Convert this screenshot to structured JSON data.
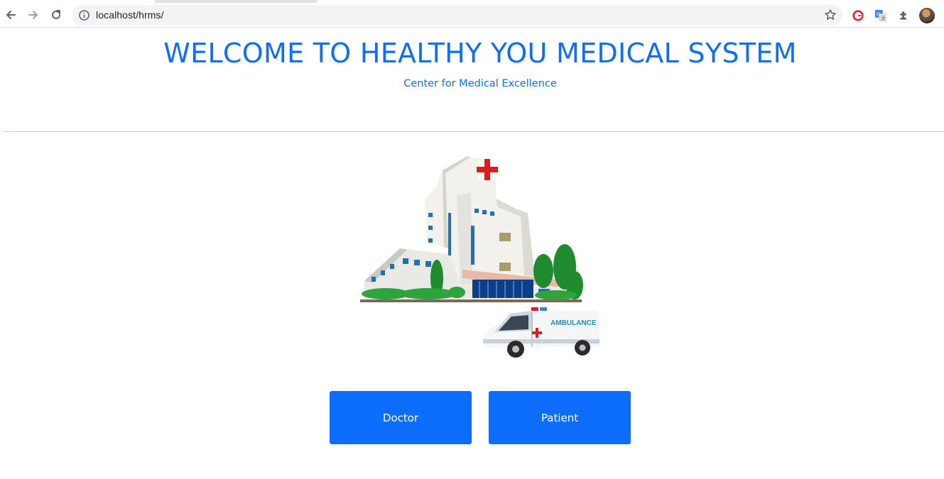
{
  "browser": {
    "url": "localhost/hrms/",
    "icons": [
      "back-icon",
      "forward-icon",
      "reload-icon",
      "info-icon",
      "bookmark-star-icon",
      "grammarly-extension-icon",
      "google-translate-extension-icon",
      "extensions-puzzle-icon",
      "profile-avatar"
    ]
  },
  "header": {
    "title": "WELCOME TO HEALTHY YOU MEDICAL SYSTEM",
    "subtitle": "Center for Medical Excellence"
  },
  "illustration": {
    "ambulance_text": "AMBULANCE"
  },
  "buttons": {
    "doctor": "Doctor",
    "patient": "Patient"
  },
  "colors": {
    "primary": "#0d6efd",
    "divider": "#f3b9b9"
  }
}
